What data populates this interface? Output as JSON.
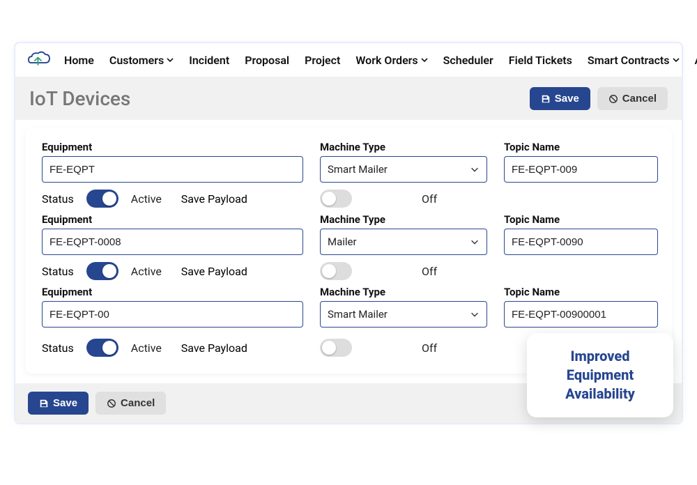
{
  "nav": {
    "items": [
      {
        "label": "Home",
        "dropdown": false
      },
      {
        "label": "Customers",
        "dropdown": true
      },
      {
        "label": "Incident",
        "dropdown": false
      },
      {
        "label": "Proposal",
        "dropdown": false
      },
      {
        "label": "Project",
        "dropdown": false
      },
      {
        "label": "Work Orders",
        "dropdown": true
      },
      {
        "label": "Scheduler",
        "dropdown": false
      },
      {
        "label": "Field Tickets",
        "dropdown": false
      },
      {
        "label": "Smart Contracts",
        "dropdown": true
      },
      {
        "label": "Assets",
        "dropdown": true
      }
    ]
  },
  "page": {
    "title": "IoT Devices",
    "save_label": "Save",
    "cancel_label": "Cancel"
  },
  "labels": {
    "equipment": "Equipment",
    "machine_type": "Machine Type",
    "topic_name": "Topic Name",
    "status": "Status",
    "save_payload": "Save Payload"
  },
  "devices": [
    {
      "equipment": "FE-EQPT",
      "machine_type": "Smart Mailer",
      "topic_name": "FE-EQPT-009",
      "status_on": true,
      "status_text": "Active",
      "payload_on": false,
      "payload_text": "Off"
    },
    {
      "equipment": "FE-EQPT-0008",
      "machine_type": "Mailer",
      "topic_name": "FE-EQPT-0090",
      "status_on": true,
      "status_text": "Active",
      "payload_on": false,
      "payload_text": "Off"
    },
    {
      "equipment": "FE-EQPT-00",
      "machine_type": "Smart Mailer",
      "topic_name": "FE-EQPT-00900001",
      "status_on": true,
      "status_text": "Active",
      "payload_on": false,
      "payload_text": "Off"
    }
  ],
  "footer": {
    "save_label": "Save",
    "cancel_label": "Cancel"
  },
  "callout": {
    "line1": "Improved",
    "line2": "Equipment",
    "line3": "Availability"
  },
  "colors": {
    "primary": "#274690",
    "muted_bg": "#f1f1f1"
  }
}
